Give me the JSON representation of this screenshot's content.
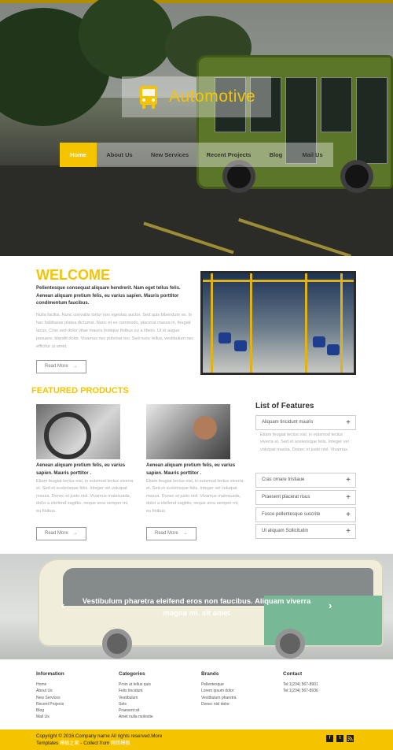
{
  "header": {
    "logo_text": "Automotive",
    "nav": [
      {
        "label": "Home",
        "active": true
      },
      {
        "label": "About Us",
        "active": false
      },
      {
        "label": "New Services",
        "active": false
      },
      {
        "label": "Recent Projects",
        "active": false
      },
      {
        "label": "Blog",
        "active": false
      },
      {
        "label": "Mail Us",
        "active": false
      }
    ]
  },
  "welcome": {
    "title": "WELCOME",
    "lead": "Pellentesque consequat aliquam hendrerit. Nam eget tellus felis. Aenean aliquam pretium felis, eu varius sapien. Mauris porttitor condimentum faucibus.",
    "body": "Nulla facilisi. Nunc convallis tortor non egestas auctor. Sed quis bibendum ex. In hac habitasse platea dictumst. Nunc et ex commodo, placerat massa in, feugiat lacus. Cras sed dolor vitae mauris tristique finibus eu a libero. Ut id augue posuere, blandit dolor. Vivamus nec pulvinar leo. Sed nunc tellus, vestibulum nec efficitur ut amet.",
    "button": "Read More",
    "button_arrow": "→"
  },
  "featured": {
    "title": "FEATURED PRODUCTS",
    "products": [
      {
        "title": "Aenean aliquam pretium felis, eu varius sapien. Mauris porttitor .",
        "body": "Etiam feugiat lectus nisl, in euismod lectus viverra et. Sed et scelerisque felis. Integer vel volutpat massa. Donec et justo nisl. Vivamus malesuada, dolor a eleifend sagittis, neque arcu semper mi, eu finibus.",
        "button": "Read More",
        "button_arrow": "→"
      },
      {
        "title": "Aenean aliquam pretium felis, eu varius sapien. Mauris porttitor .",
        "body": "Etiam feugiat lectus nisl, in euismod lectus viverra et. Sed et scelerisque felis. Integer vel volutpat massa. Donec et justo nisl. Vivamus malesuada, dolor a eleifend sagittis, neque arcu semper mi, eu finibus.",
        "button": "Read More",
        "button_arrow": "→"
      }
    ]
  },
  "features": {
    "title": "List of Features",
    "expanded_body": "Etiam feugiat lectus nisl, in euismod lectus viverra et. Sed et scelerisque felis. Integer vel volutpat massa. Donec et justo nisl. Vivamus.",
    "items": [
      "Aliquam tincidunt mauris",
      "Cras ornare tristiaue",
      "Praesent placerat risus",
      "Fusce pellentesque suscrite",
      "Ut aliquam Sollicitudin"
    ],
    "toggle_symbol": "+"
  },
  "banner": {
    "caption": "Vestibulum pharetra eleifend eros non faucibus. Aliquam viverra magna mi, sit amet",
    "prev": "‹",
    "next": "›"
  },
  "footer": {
    "columns": [
      {
        "heading": "Information",
        "items": [
          "Home",
          "About Us",
          "New Services",
          "Recent Projects",
          "Blog",
          "Mail Us"
        ]
      },
      {
        "heading": "Categories",
        "items": [
          "Proin at tellus quis",
          "Felis tincidunt",
          "Vestibulum",
          "Sets",
          "Praesent sit",
          "Amet nulla molestie"
        ]
      },
      {
        "heading": "Brands",
        "items": [
          "Pellentesque",
          "Lorem ipsum dolor",
          "Vestibulum pharetra",
          "Donec nisl dolor"
        ]
      },
      {
        "heading": "Contact",
        "items": [
          "Tel:1(234) 567-8901",
          "Tel:1(234) 567-8936"
        ]
      }
    ],
    "copyright_line1": "Copyright © 2016.Company name All rights reserved.More",
    "copyright_line2_a": "Templates",
    "copyright_line2_link1": "模板之家",
    "copyright_line2_b": "- Collect from",
    "copyright_line2_link2": "网页模板",
    "social": [
      "f",
      "t",
      "rss"
    ]
  },
  "colors": {
    "accent": "#f5c400",
    "dark": "#333333",
    "muted": "#aaaaaa"
  }
}
